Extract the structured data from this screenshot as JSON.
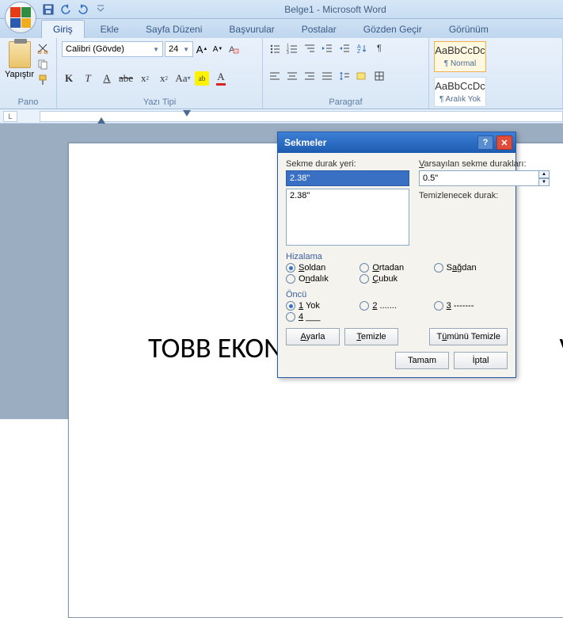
{
  "app": {
    "title": "Belge1 - Microsoft Word"
  },
  "qat": {
    "save": "save-icon",
    "undo": "undo-icon",
    "redo": "redo-icon"
  },
  "tabs": [
    "Giriş",
    "Ekle",
    "Sayfa Düzeni",
    "Başvurular",
    "Postalar",
    "Gözden Geçir",
    "Görünüm"
  ],
  "active_tab": 0,
  "ribbon": {
    "pano": {
      "paste_label": "Yapıştır",
      "group_label": "Pano"
    },
    "font": {
      "name": "Calibri (Gövde)",
      "size": "24",
      "group_label": "Yazı Tipi"
    },
    "paragraph": {
      "group_label": "Paragraf"
    },
    "styles": [
      {
        "sample": "AaBbCcDc",
        "name": "¶ Normal"
      },
      {
        "sample": "AaBbCcDc",
        "name": "¶ Aralık Yok"
      }
    ]
  },
  "ruler": {
    "corner": "L"
  },
  "document": {
    "visible_text": "TOBB EKONO",
    "visible_text_right": "VERS"
  },
  "dialog": {
    "title": "Sekmeler",
    "tab_stop_label": "Sekme durak yeri:",
    "tab_stop_value": "2.38\"",
    "tab_list": [
      "2.38\""
    ],
    "default_label": "Varsayılan sekme durakları:",
    "default_value": "0.5\"",
    "clear_label": "Temizlenecek durak:",
    "alignment_label": "Hizalama",
    "alignment": {
      "left": "Soldan",
      "center": "Ortadan",
      "right": "Sağdan",
      "decimal": "Ondalık",
      "bar": "Çubuk"
    },
    "alignment_selected": "left",
    "leader_label": "Öncü",
    "leader": {
      "l1": "1 Yok",
      "l2": "2 .......",
      "l3": "3 -------",
      "l4": "4 ___"
    },
    "leader_selected": "l1",
    "buttons": {
      "set": "Ayarla",
      "clear": "Temizle",
      "clear_all": "Tümünü Temizle",
      "ok": "Tamam",
      "cancel": "İptal"
    }
  }
}
